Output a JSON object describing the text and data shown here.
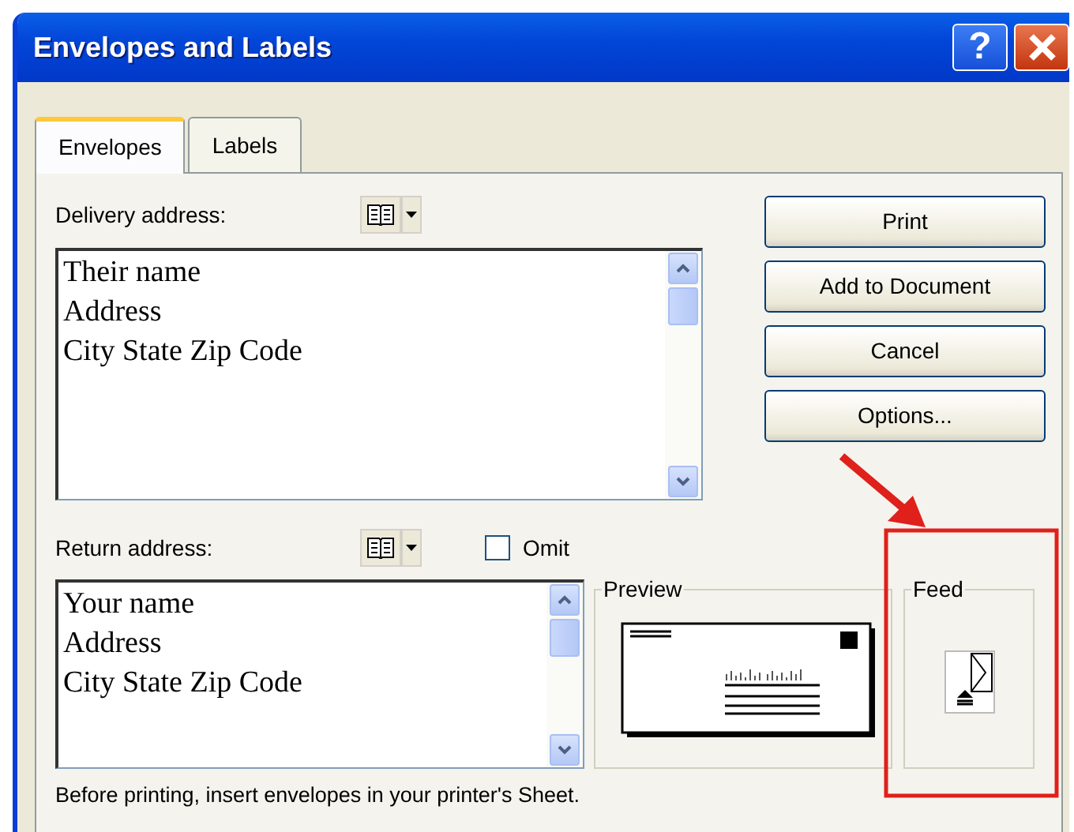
{
  "window": {
    "title": "Envelopes and Labels",
    "help": "?"
  },
  "tabs": [
    {
      "label": "Envelopes",
      "selected": true
    },
    {
      "label": "Labels",
      "selected": false
    }
  ],
  "delivery": {
    "label": "Delivery address:",
    "lines": [
      "Their name",
      "Address",
      "City State Zip Code"
    ]
  },
  "buttons": [
    {
      "label": "Print"
    },
    {
      "label": "Add to Document"
    },
    {
      "label": "Cancel"
    },
    {
      "label": "Options..."
    }
  ],
  "return": {
    "label": "Return address:",
    "lines": [
      "Your name",
      "Address",
      "City State Zip Code"
    ],
    "omit": {
      "label": "Omit",
      "checked": false
    }
  },
  "preview": {
    "title": "Preview"
  },
  "feed": {
    "title": "Feed"
  },
  "note": "Before printing, insert envelopes in your printer's Sheet.",
  "annotation": {
    "kind": "arrow-box"
  }
}
